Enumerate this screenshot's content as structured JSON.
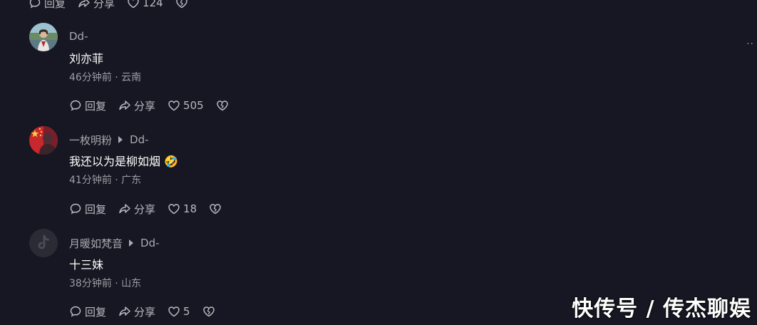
{
  "top_actions": {
    "reply": "回复",
    "share": "分享",
    "likes": "124"
  },
  "comments": [
    {
      "author": "Dd-",
      "reply_to": "",
      "text": "刘亦菲",
      "meta": "46分钟前 · 云南",
      "reply": "回复",
      "share": "分享",
      "likes": "505"
    },
    {
      "author": "一枚明粉",
      "reply_to": "Dd-",
      "text": "我还以为是柳如烟",
      "emoji": "🤣",
      "meta": "41分钟前 · 广东",
      "reply": "回复",
      "share": "分享",
      "likes": "18"
    },
    {
      "author": "月暖如梵音",
      "reply_to": "Dd-",
      "text": "十三妹",
      "meta": "38分钟前 · 山东",
      "reply": "回复",
      "share": "分享",
      "likes": "5"
    }
  ],
  "more_menu": "··",
  "watermark": "快传号 / 传杰聊娱",
  "colors": {
    "background": "#161722",
    "text_primary": "#ffffff",
    "text_secondary": "#a8a9b0"
  }
}
